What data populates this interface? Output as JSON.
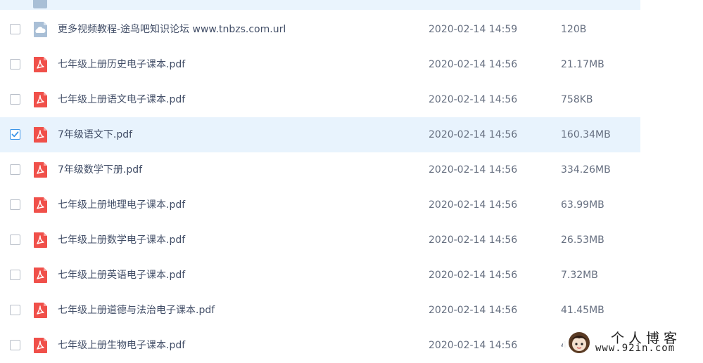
{
  "files": [
    {
      "name": "更多视频教程-途鸟吧知识论坛 www.tnbzs.com.url",
      "date": "2020-02-14 14:59",
      "size": "120B",
      "type": "url",
      "icon": "url-file-icon",
      "selected": false
    },
    {
      "name": "七年级上册历史电子课本.pdf",
      "date": "2020-02-14 14:56",
      "size": "21.17MB",
      "type": "pdf",
      "icon": "pdf-file-icon",
      "selected": false
    },
    {
      "name": "七年级上册语文电子课本.pdf",
      "date": "2020-02-14 14:56",
      "size": "758KB",
      "type": "pdf",
      "icon": "pdf-file-icon",
      "selected": false
    },
    {
      "name": "7年级语文下.pdf",
      "date": "2020-02-14 14:56",
      "size": "160.34MB",
      "type": "pdf",
      "icon": "pdf-file-icon",
      "selected": true
    },
    {
      "name": "7年级数学下册.pdf",
      "date": "2020-02-14 14:56",
      "size": "334.26MB",
      "type": "pdf",
      "icon": "pdf-file-icon",
      "selected": false
    },
    {
      "name": "七年级上册地理电子课本.pdf",
      "date": "2020-02-14 14:56",
      "size": "63.99MB",
      "type": "pdf",
      "icon": "pdf-file-icon",
      "selected": false
    },
    {
      "name": "七年级上册数学电子课本.pdf",
      "date": "2020-02-14 14:56",
      "size": "26.53MB",
      "type": "pdf",
      "icon": "pdf-file-icon",
      "selected": false
    },
    {
      "name": "七年级上册英语电子课本.pdf",
      "date": "2020-02-14 14:56",
      "size": "7.32MB",
      "type": "pdf",
      "icon": "pdf-file-icon",
      "selected": false
    },
    {
      "name": "七年级上册道德与法治电子课本.pdf",
      "date": "2020-02-14 14:56",
      "size": "41.45MB",
      "type": "pdf",
      "icon": "pdf-file-icon",
      "selected": false
    },
    {
      "name": "七年级上册生物电子课本.pdf",
      "date": "2020-02-14 14:56",
      "size": "4",
      "type": "pdf",
      "icon": "pdf-file-icon",
      "selected": false
    }
  ],
  "watermark": {
    "title": "个人博客",
    "url": "www.92in.com"
  },
  "colors": {
    "pdf": "#f0504a",
    "url": "#a9bfd6",
    "selected_row": "#e8f3fd",
    "check": "#3b94e8"
  }
}
